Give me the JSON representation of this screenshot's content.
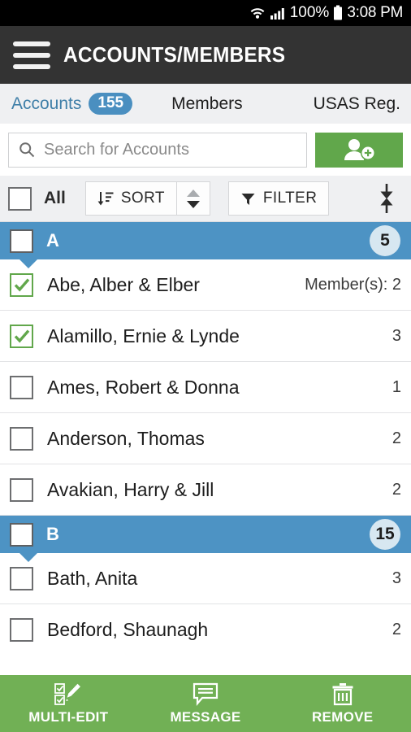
{
  "status_bar": {
    "wifi_icon": "wifi-icon",
    "signal_icon": "cellular-signal-icon",
    "battery_percent": "100%",
    "battery_icon": "battery-full-icon",
    "time": "3:08 PM"
  },
  "app_bar": {
    "menu_icon": "hamburger-menu-icon",
    "title": "ACCOUNTS/MEMBERS",
    "bg_color": "#333333"
  },
  "tabs": [
    {
      "label": "Accounts",
      "badge": "155",
      "active": true
    },
    {
      "label": "Members",
      "badge": "",
      "active": false
    },
    {
      "label": "USAS Reg.",
      "badge": "",
      "active": false
    }
  ],
  "search": {
    "icon": "search-icon",
    "placeholder": "Search for Accounts",
    "value": ""
  },
  "add_account_button": {
    "icon": "add-user-icon",
    "color": "#61a74b"
  },
  "tools": {
    "all_label": "All",
    "all_checked": false,
    "sort_label": "SORT",
    "sort_icon": "sort-descending-icon",
    "sort_direction": "descending",
    "spinner_up_icon": "caret-up-icon",
    "spinner_down_icon": "caret-down-icon",
    "filter_label": "FILTER",
    "filter_icon": "funnel-icon",
    "collapse_all_icon": "collapse-all-icon"
  },
  "colors": {
    "section_header": "#4d93c4",
    "accent_blue": "#4a8fc0",
    "accent_green": "#61a74b",
    "bottom_bar_green": "#71b055"
  },
  "sections": [
    {
      "letter": "A",
      "count": "5",
      "checked": false,
      "expanded": true,
      "rows": [
        {
          "name": "Abe, Alber & Elber",
          "count": "Member(s): 2",
          "checked": true
        },
        {
          "name": "Alamillo, Ernie & Lynde",
          "count": "3",
          "checked": true
        },
        {
          "name": "Ames, Robert & Donna",
          "count": "1",
          "checked": false
        },
        {
          "name": "Anderson, Thomas",
          "count": "2",
          "checked": false
        },
        {
          "name": "Avakian, Harry & Jill",
          "count": "2",
          "checked": false
        }
      ]
    },
    {
      "letter": "B",
      "count": "15",
      "checked": false,
      "expanded": true,
      "rows": [
        {
          "name": "Bath, Anita",
          "count": "3",
          "checked": false
        },
        {
          "name": "Bedford, Shaunagh",
          "count": "2",
          "checked": false
        }
      ]
    }
  ],
  "bottom_bar": [
    {
      "label": "MULTI-EDIT",
      "icon": "multi-edit-icon"
    },
    {
      "label": "MESSAGE",
      "icon": "message-bubble-icon"
    },
    {
      "label": "REMOVE",
      "icon": "trash-icon"
    }
  ]
}
